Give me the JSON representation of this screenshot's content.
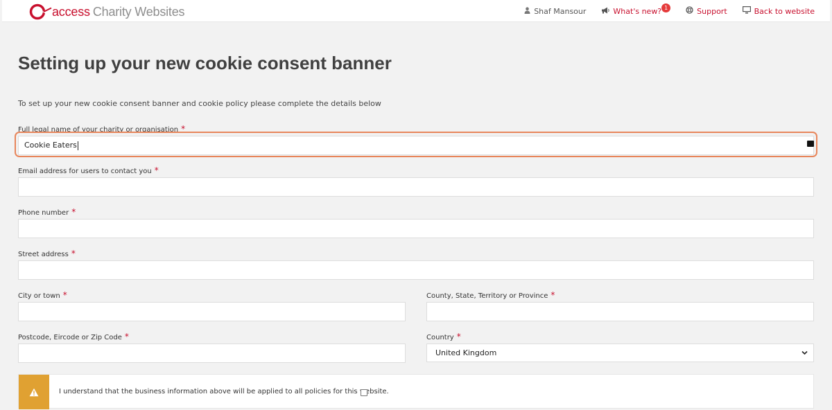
{
  "brand": {
    "name_a": "access",
    "name_b": "Charity Websites",
    "accent": "#c8102e"
  },
  "nav": {
    "user": "Shaf Mansour",
    "whats_new": "What's new?",
    "whats_new_badge": "1",
    "support": "Support",
    "back": "Back to website",
    "icons": [
      "user-icon",
      "megaphone-icon",
      "lifebuoy-icon",
      "monitor-icon"
    ]
  },
  "page": {
    "title": "Setting up your new cookie consent banner",
    "intro": "To set up your new cookie consent banner and cookie policy please complete the details below"
  },
  "form": {
    "required_mark": "*",
    "legal_name": {
      "label": "Full legal name of your charity or organisation",
      "value": "Cookie Eaters"
    },
    "email": {
      "label": "Email address for users to contact you",
      "value": ""
    },
    "phone": {
      "label": "Phone number",
      "value": ""
    },
    "street": {
      "label": "Street address",
      "value": ""
    },
    "city": {
      "label": "City or town",
      "value": ""
    },
    "county": {
      "label": "County, State, Territory or Province",
      "value": ""
    },
    "postcode": {
      "label": "Postcode, Eircode or Zip Code",
      "value": ""
    },
    "country": {
      "label": "Country",
      "value": "United Kingdom"
    }
  },
  "notice": {
    "text": "I understand that the business information above will be applied to all policies for this website.",
    "checked": false,
    "warning_color": "#e0a132"
  }
}
